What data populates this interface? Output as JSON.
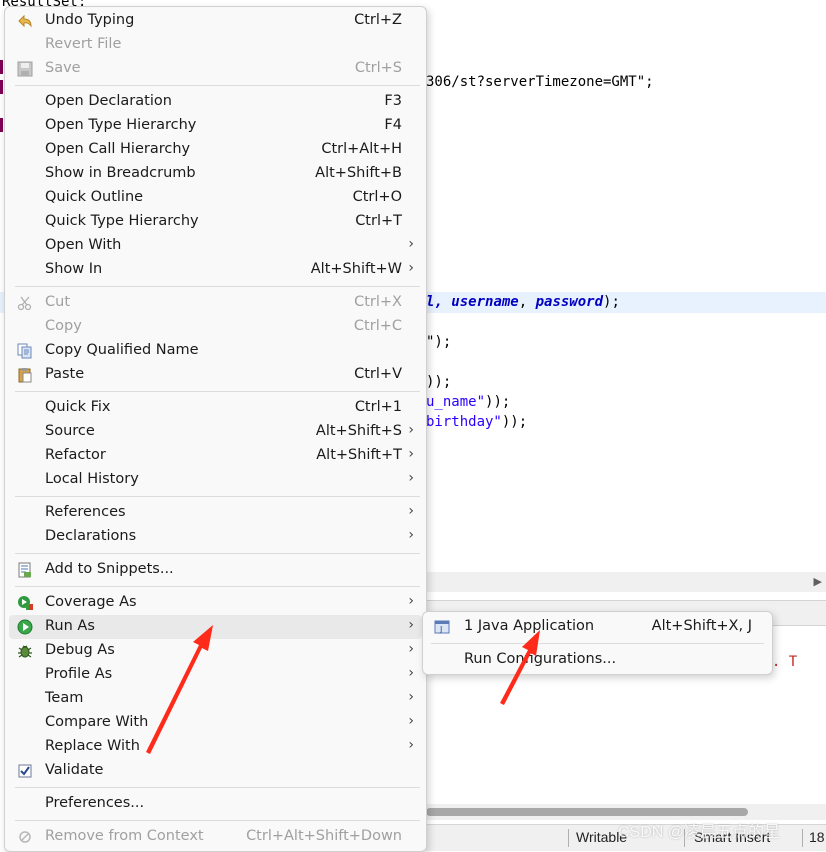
{
  "editor": {
    "line0": "ResultSet;",
    "url_line": "306/st?serverTimezone=GMT\";",
    "conn_line_pre": "l, ",
    "conn_var1": "username",
    "conn_sep": ", ",
    "conn_var2": "password",
    "conn_end": ");",
    "line_a": "\");",
    "line_b": "));",
    "line_c_str": "u_name\"",
    "line_c_end": "));",
    "line_d_str": "birthday\"",
    "line_d_end": "));"
  },
  "console": {
    "error_text": "r'. T"
  },
  "statusbar": {
    "writable": "Writable",
    "insert": "Smart Insert",
    "position": "18"
  },
  "watermark": "CSDN @凌晨五点的星",
  "menu": {
    "items": [
      {
        "label": "Undo Typing",
        "acc": "Ctrl+Z"
      },
      {
        "label": "Revert File",
        "acc": ""
      },
      {
        "label": "Save",
        "acc": "Ctrl+S"
      },
      {
        "label": "Open Declaration",
        "acc": "F3"
      },
      {
        "label": "Open Type Hierarchy",
        "acc": "F4"
      },
      {
        "label": "Open Call Hierarchy",
        "acc": "Ctrl+Alt+H"
      },
      {
        "label": "Show in Breadcrumb",
        "acc": "Alt+Shift+B"
      },
      {
        "label": "Quick Outline",
        "acc": "Ctrl+O"
      },
      {
        "label": "Quick Type Hierarchy",
        "acc": "Ctrl+T"
      },
      {
        "label": "Open With",
        "acc": ""
      },
      {
        "label": "Show In",
        "acc": "Alt+Shift+W"
      },
      {
        "label": "Cut",
        "acc": "Ctrl+X"
      },
      {
        "label": "Copy",
        "acc": "Ctrl+C"
      },
      {
        "label": "Copy Qualified Name",
        "acc": ""
      },
      {
        "label": "Paste",
        "acc": "Ctrl+V"
      },
      {
        "label": "Quick Fix",
        "acc": "Ctrl+1"
      },
      {
        "label": "Source",
        "acc": "Alt+Shift+S"
      },
      {
        "label": "Refactor",
        "acc": "Alt+Shift+T"
      },
      {
        "label": "Local History",
        "acc": ""
      },
      {
        "label": "References",
        "acc": ""
      },
      {
        "label": "Declarations",
        "acc": ""
      },
      {
        "label": "Add to Snippets...",
        "acc": ""
      },
      {
        "label": "Coverage As",
        "acc": ""
      },
      {
        "label": "Run As",
        "acc": ""
      },
      {
        "label": "Debug As",
        "acc": ""
      },
      {
        "label": "Profile As",
        "acc": ""
      },
      {
        "label": "Team",
        "acc": ""
      },
      {
        "label": "Compare With",
        "acc": ""
      },
      {
        "label": "Replace With",
        "acc": ""
      },
      {
        "label": "Validate",
        "acc": ""
      },
      {
        "label": "Preferences...",
        "acc": ""
      },
      {
        "label": "Remove from Context",
        "acc": "Ctrl+Alt+Shift+Down"
      }
    ]
  },
  "submenu": {
    "items": [
      {
        "label": "1 Java Application",
        "acc": "Alt+Shift+X, J"
      },
      {
        "label": "Run Configurations...",
        "acc": ""
      }
    ]
  },
  "colors": {
    "annotation_arrow": "#ff2a1a",
    "menu_bg": "#f9f9f9",
    "hover_bg": "#e9e9e9",
    "string": "#2a00ff"
  },
  "icons": [
    "undo-icon",
    "save-icon",
    "cut-icon",
    "copy-icon",
    "copy-qualified-icon",
    "paste-icon",
    "snippet-icon",
    "coverage-icon",
    "run-icon",
    "debug-icon",
    "check-icon",
    "remove-context-icon",
    "java-app-icon"
  ]
}
